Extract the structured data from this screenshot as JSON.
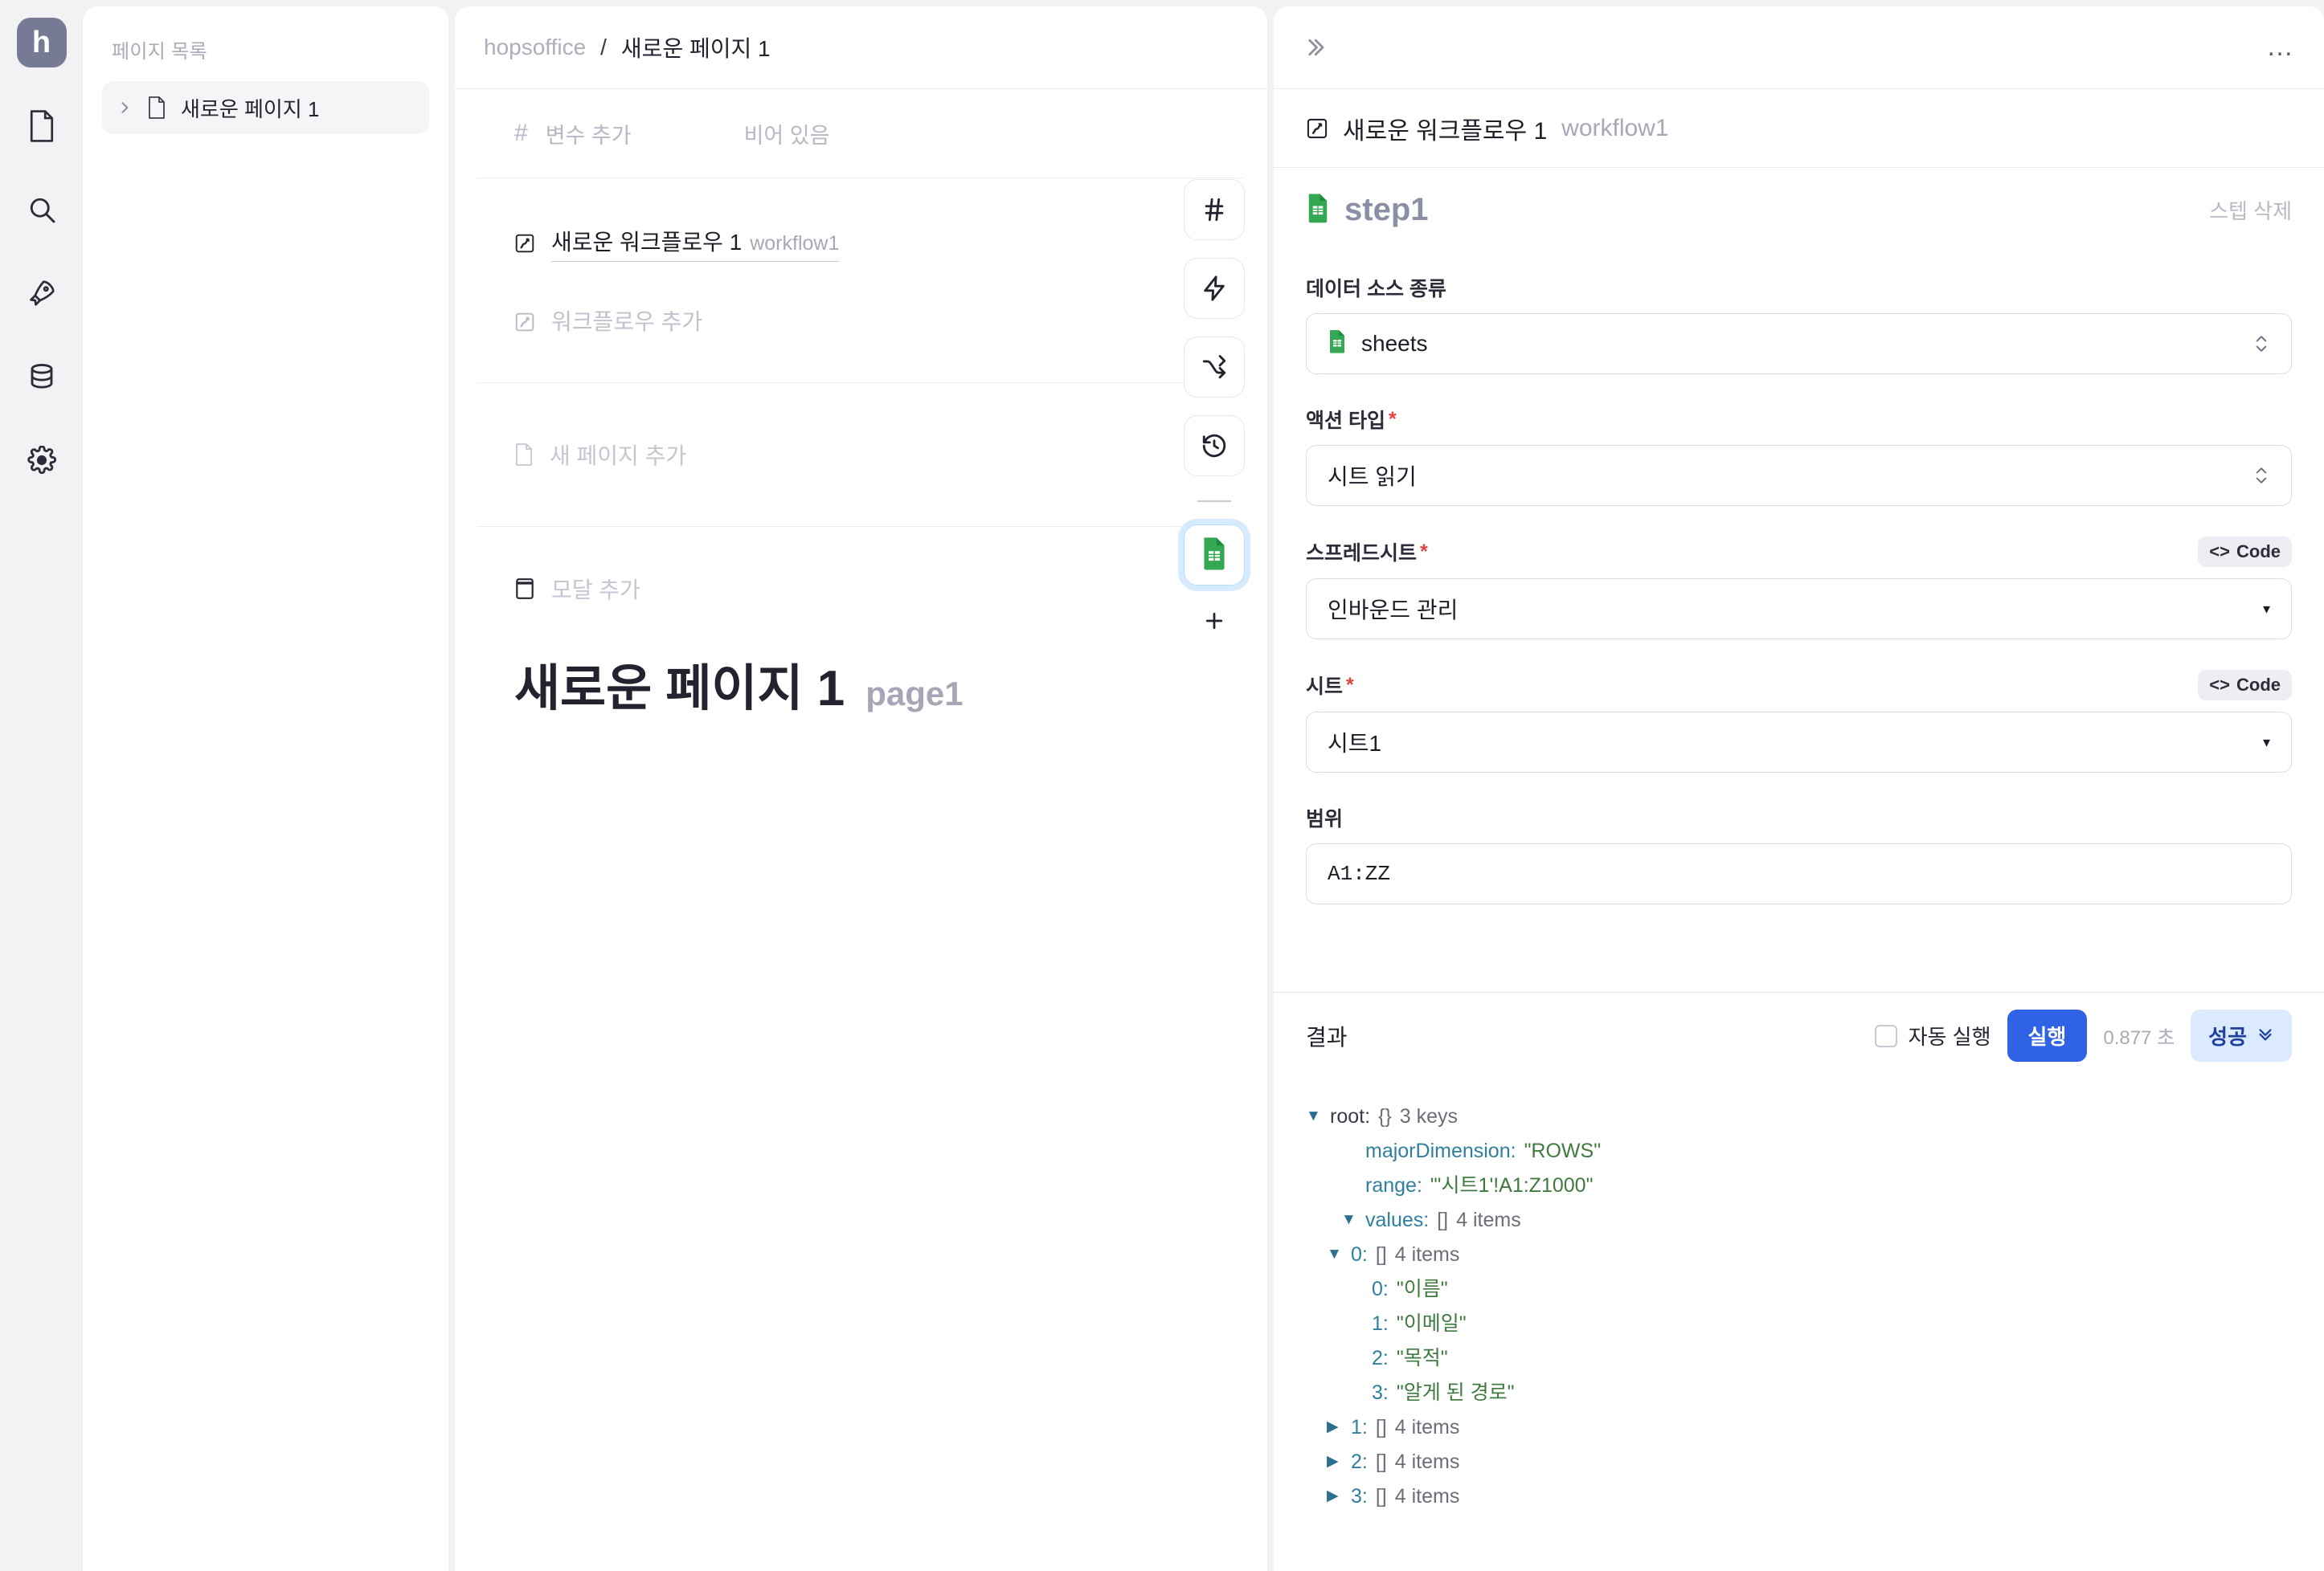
{
  "rail": {
    "logo_text": "h",
    "items": [
      {
        "name": "document-icon"
      },
      {
        "name": "search-icon"
      },
      {
        "name": "rocket-icon"
      },
      {
        "name": "database-icon"
      },
      {
        "name": "gear-icon"
      }
    ]
  },
  "pagelist": {
    "title": "페이지 목록",
    "items": [
      {
        "label": "새로운 페이지 1"
      }
    ]
  },
  "breadcrumb": {
    "root": "hopsoffice",
    "separator": "/",
    "current": "새로운 페이지 1"
  },
  "canvas": {
    "variable_add": "변수 추가",
    "variable_empty": "비어 있음",
    "workflow": {
      "name": "새로운 워크플로우 1",
      "slug": "workflow1"
    },
    "workflow_add": "워크플로우 추가",
    "page_add": "새 페이지 추가",
    "modal_add": "모달 추가",
    "page_title": "새로운 페이지 1",
    "page_slug": "page1"
  },
  "toolbar": {
    "buttons": [
      {
        "name": "variable-hash-button",
        "glyph": "#"
      },
      {
        "name": "action-bolt-button",
        "glyph": "bolt"
      },
      {
        "name": "branch-button",
        "glyph": "shuffle"
      },
      {
        "name": "history-button",
        "glyph": "history"
      }
    ],
    "sheets_button": "sheets-step-button",
    "add_button": "+"
  },
  "inspector": {
    "collapse_icon": "»",
    "more_icon": "…",
    "workflow": {
      "name": "새로운 워크플로우 1",
      "slug": "workflow1"
    },
    "step": {
      "name": "step1",
      "delete_label": "스텝 삭제"
    },
    "fields": [
      {
        "label": "데이터 소스 종류",
        "required": false,
        "code_label": null,
        "value": "sheets",
        "control": "stepper",
        "icon": "sheets-icon"
      },
      {
        "label": "액션 타입",
        "required": true,
        "code_label": null,
        "value": "시트 읽기",
        "control": "stepper",
        "icon": null
      },
      {
        "label": "스프레드시트",
        "required": true,
        "code_label": "Code",
        "value": "인바운드 관리",
        "control": "select",
        "icon": null
      },
      {
        "label": "시트",
        "required": true,
        "code_label": "Code",
        "value": "시트1",
        "control": "select",
        "icon": null
      },
      {
        "label": "범위",
        "required": false,
        "code_label": null,
        "value": "A1:ZZ",
        "control": "text",
        "icon": null
      }
    ],
    "results": {
      "title": "결과",
      "auto_run_label": "자동 실행",
      "auto_run_checked": false,
      "run_label": "실행",
      "elapsed": "0.877 초",
      "status_label": "성공"
    },
    "tree": [
      {
        "indent": 0,
        "arrow": "down",
        "key": "root:",
        "meta_brace": "{}",
        "meta": "3 keys",
        "value": null
      },
      {
        "indent": 1,
        "arrow": "none",
        "key": "majorDimension:",
        "meta_brace": null,
        "meta": null,
        "value": "\"ROWS\""
      },
      {
        "indent": 1,
        "arrow": "none",
        "key": "range:",
        "meta_brace": null,
        "meta": null,
        "value": "\"'시트1'!A1:Z1000\""
      },
      {
        "indent": 1,
        "arrow": "down",
        "key": "values:",
        "meta_brace": "[]",
        "meta": "4 items",
        "value": null
      },
      {
        "indent": 2,
        "arrow": "down",
        "key": "0:",
        "meta_brace": "[]",
        "meta": "4 items",
        "value": null
      },
      {
        "indent": 3,
        "arrow": "none",
        "key": "0:",
        "meta_brace": null,
        "meta": null,
        "value": "\"이름\""
      },
      {
        "indent": 3,
        "arrow": "none",
        "key": "1:",
        "meta_brace": null,
        "meta": null,
        "value": "\"이메일\""
      },
      {
        "indent": 3,
        "arrow": "none",
        "key": "2:",
        "meta_brace": null,
        "meta": null,
        "value": "\"목적\""
      },
      {
        "indent": 3,
        "arrow": "none",
        "key": "3:",
        "meta_brace": null,
        "meta": null,
        "value": "\"알게 된 경로\""
      },
      {
        "indent": 2,
        "arrow": "right",
        "key": "1:",
        "meta_brace": "[]",
        "meta": "4 items",
        "value": null
      },
      {
        "indent": 2,
        "arrow": "right",
        "key": "2:",
        "meta_brace": "[]",
        "meta": "4 items",
        "value": null
      },
      {
        "indent": 2,
        "arrow": "right",
        "key": "3:",
        "meta_brace": "[]",
        "meta": "4 items",
        "value": null
      }
    ]
  },
  "colors": {
    "accent_blue": "#2f62e4",
    "badge_blue_bg": "#dbeafe",
    "sheets_green": "#34a853",
    "logo_bg": "#777a94",
    "required_red": "#e0443e"
  }
}
